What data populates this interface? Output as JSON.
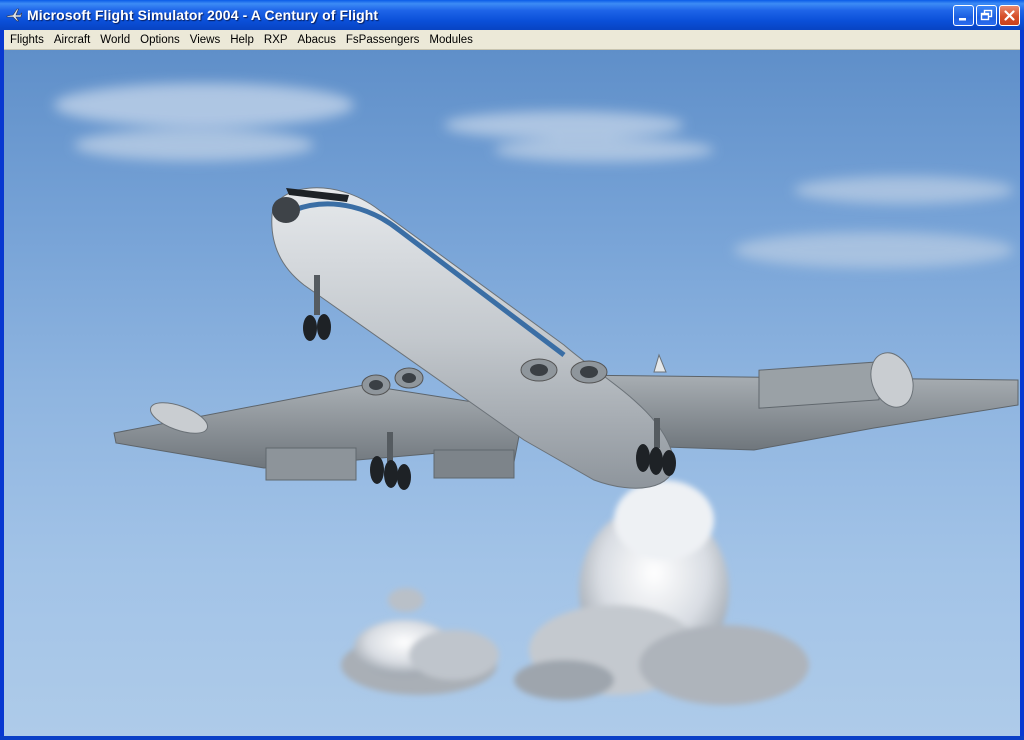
{
  "window": {
    "title": "Microsoft Flight Simulator 2004 - A Century of Flight",
    "app_icon": "airplane-icon",
    "controls": [
      "minimize-icon",
      "restore-icon",
      "close-icon"
    ]
  },
  "menubar": {
    "items": [
      "Flights",
      "Aircraft",
      "World",
      "Options",
      "Views",
      "Help",
      "RXP",
      "Abacus",
      "FsPassengers",
      "Modules"
    ]
  },
  "scene": {
    "description_tag": "flight-view",
    "sky_top": "#5f8fc9",
    "sky_bottom": "#aecbe9",
    "aircraft_livery": "#c9cdd1",
    "cheatline": "#3a6ea5"
  }
}
